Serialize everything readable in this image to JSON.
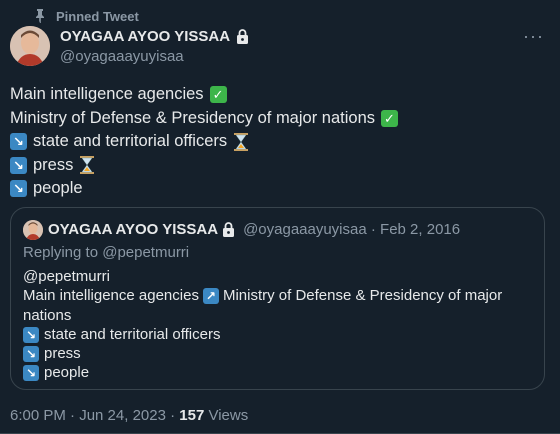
{
  "pinned": {
    "label": "Pinned Tweet"
  },
  "author": {
    "name": "OYAGAA AYOO YISSAA",
    "handle": "@oyagaaayuyisaa"
  },
  "tweet": {
    "line1": "Main intelligence agencies",
    "line2": "Ministry of Defense & Presidency of major nations",
    "line3": "state and territorial officers",
    "line4": "press",
    "line5": "people"
  },
  "quote": {
    "name": "OYAGAA AYOO YISSAA",
    "handle_date": "@oyagaaayuyisaa · Feb 2, 2016",
    "reply_to": "Replying to @pepetmurri",
    "line1": "@pepetmurri",
    "line2a": "Main intelligence agencies",
    "line2b": "Ministry of Defense & Presidency of major",
    "line2c": "nations",
    "line3": "state and territorial officers",
    "line4": "press",
    "line5": "people"
  },
  "footer": {
    "time": "6:00 PM · Jun 24, 2023 · ",
    "views_count": "157",
    "views_label": " Views"
  },
  "colors": {
    "bg": "#15202b",
    "text": "#e7e9ea",
    "muted": "#8b98a5",
    "border": "#38444d",
    "check": "#3db54a",
    "arrow": "#3b88c3"
  },
  "icons": {
    "pin": "pin-icon",
    "lock": "lock-icon",
    "more": "more-icon",
    "check": "check-emoji",
    "arrow": "arrow-emoji",
    "hourglass": "hourglass-emoji"
  }
}
